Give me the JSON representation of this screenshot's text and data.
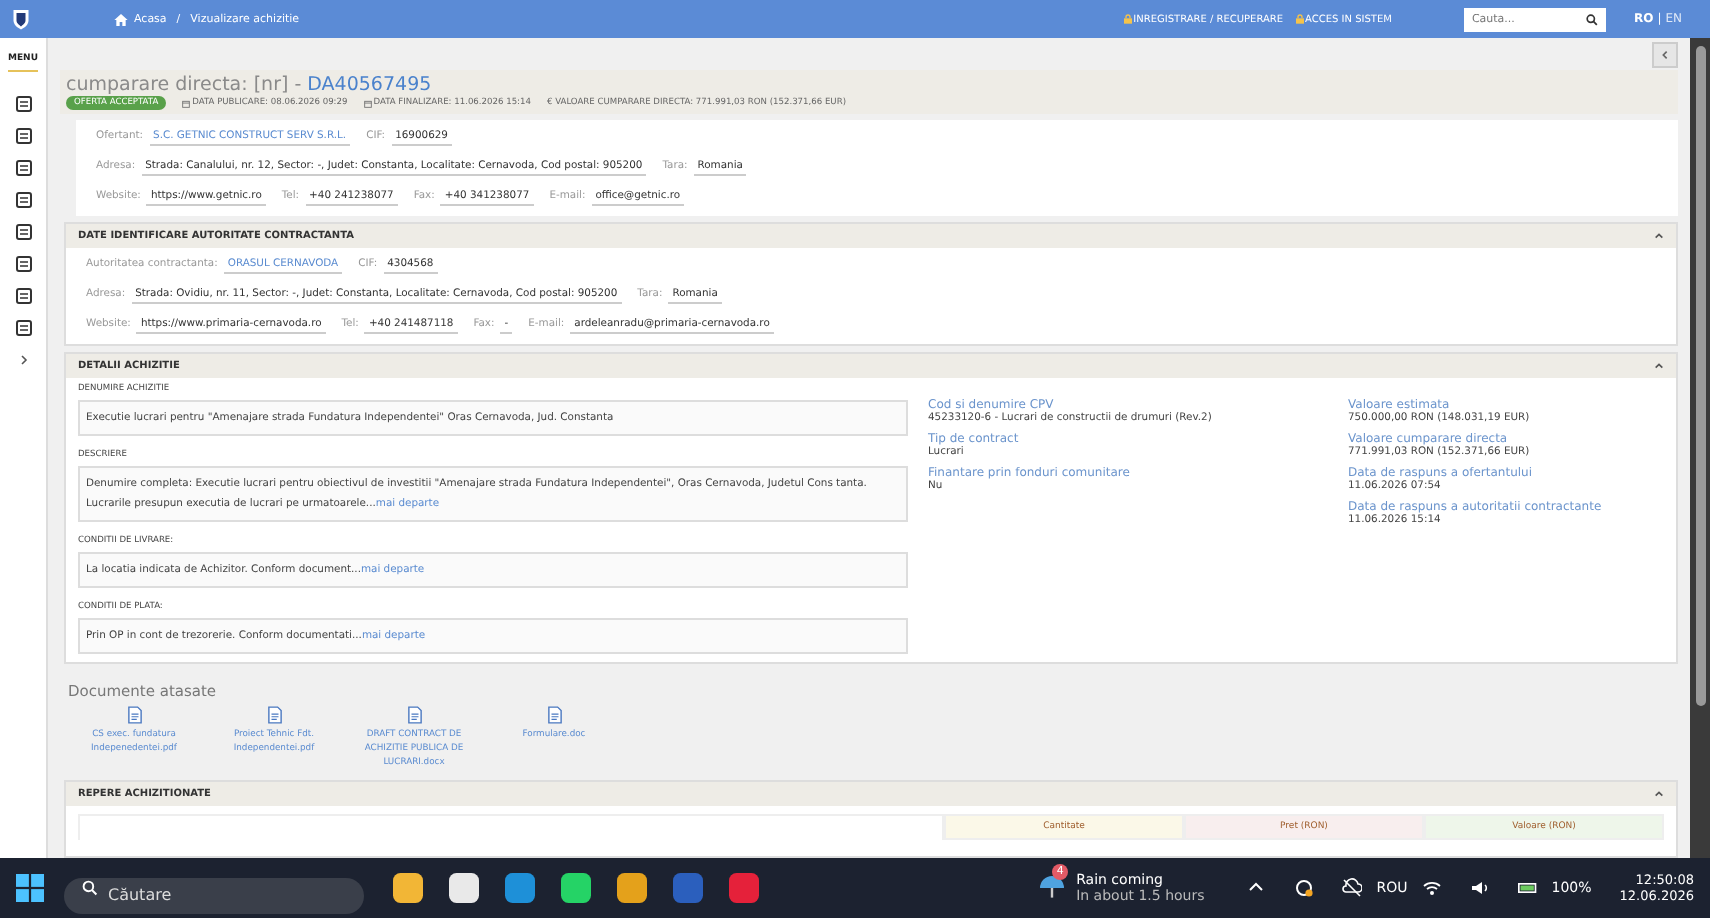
{
  "header": {
    "breadcrumb": [
      "Acasa",
      "Vizualizare achizitie"
    ],
    "breadcrumb_separator": "/",
    "links": [
      "INREGISTRARE / RECUPERARE",
      "ACCES IN SISTEM"
    ],
    "search": {
      "placeholder": "Cauta..."
    },
    "languages": [
      {
        "label": "RO",
        "selected": true
      },
      {
        "label": "EN",
        "selected": false
      }
    ],
    "language_separator": "|"
  },
  "sidebar": {
    "menu_label": "MENU"
  },
  "procurement": {
    "title": "cumparare directa: [nr] - ",
    "code": "DA40567495",
    "status": "OFERTA ACCEPTATA",
    "meta": [
      {
        "kind": "date",
        "text": "DATA PUBLICARE: 08.06.2026 09:29"
      },
      {
        "kind": "date",
        "text": "DATA FINALIZARE: 11.06.2026 15:14"
      },
      {
        "kind": "money",
        "text": "€ VALOARE CUMPARARE DIRECTA: 771.991,03  RON (152.371,66  EUR)"
      }
    ]
  },
  "bidder": {
    "lines": [
      {
        "fields": [
          {
            "label": "Ofertant:",
            "value": "S.C. GETNIC CONSTRUCT SERV S.R.L.",
            "link": true
          },
          {
            "label": "CIF:",
            "value": "16900629",
            "link": false
          }
        ]
      },
      {
        "fields": [
          {
            "label": "Adresa:",
            "value": "Strada: Canalului, nr. 12, Sector: -, Judet: Constanta, Localitate: Cernavoda, Cod postal: 905200",
            "link": false
          },
          {
            "label": "Tara:",
            "value": "Romania",
            "link": false
          }
        ]
      },
      {
        "fields": [
          {
            "label": "Website:",
            "value": "https://www.getnic.ro",
            "link": false
          },
          {
            "label": "Tel:",
            "value": "+40 241238077",
            "link": false
          },
          {
            "label": "Fax:",
            "value": "+40 341238077",
            "link": false
          },
          {
            "label": "E-mail:",
            "value": "office@getnic.ro",
            "link": false
          }
        ]
      }
    ]
  },
  "authority": {
    "title": "DATE IDENTIFICARE AUTORITATE CONTRACTANTA",
    "expanded": true,
    "lines": [
      {
        "fields": [
          {
            "label": "Autoritatea contractanta:",
            "value": "ORASUL CERNAVODA",
            "link": true
          },
          {
            "label": "CIF:",
            "value": "4304568",
            "link": false
          }
        ]
      },
      {
        "fields": [
          {
            "label": "Adresa:",
            "value": "Strada: Ovidiu, nr. 11, Sector: -, Judet: Constanta, Localitate: Cernavoda, Cod postal: 905200",
            "link": false
          },
          {
            "label": "Tara:",
            "value": "Romania",
            "link": false
          }
        ]
      },
      {
        "fields": [
          {
            "label": "Website:",
            "value": "https://www.primaria-cernavoda.ro",
            "link": false
          },
          {
            "label": "Tel:",
            "value": "+40 241487118",
            "link": false
          },
          {
            "label": "Fax:",
            "value": "-",
            "link": false
          },
          {
            "label": "E-mail:",
            "value": "ardeleanradu@primaria-cernavoda.ro",
            "link": false
          }
        ]
      }
    ]
  },
  "details": {
    "title": "DETALII ACHIZITIE",
    "expanded": true,
    "fields": [
      {
        "label": "DENUMIRE ACHIZITIE",
        "value": "Executie lucrari pentru \"Amenajare strada Fundatura Independentei\" Oras Cernavoda, Jud. Constanta"
      },
      {
        "label": "DESCRIERE",
        "value": "Denumire completa: Executie lucrari pentru obiectivul de investitii \"Amenajare strada Fundatura Independentei\", Oras Cernavoda, Judetul Cons tanta. Lucrarile presupun executia de lucrari pe urmatoarele...",
        "more": "mai departe"
      },
      {
        "label": "CONDITII DE LIVRARE:",
        "value": "La locatia indicata de Achizitor. Conform document...",
        "more": "mai departe"
      },
      {
        "label": "CONDITII DE PLATA:",
        "value": "Prin OP in cont de trezorerie. Conform documentati...",
        "more": "mai departe"
      }
    ],
    "column_2": [
      {
        "label": "Cod si denumire CPV",
        "value": "45233120-6 - Lucrari de constructii de drumuri (Rev.2)"
      },
      {
        "label": "Tip de contract",
        "value": "Lucrari"
      },
      {
        "label": "Finantare prin fonduri comunitare",
        "value": "Nu"
      }
    ],
    "column_3": [
      {
        "label": "Valoare estimata",
        "value": "750.000,00  RON (148.031,19  EUR)"
      },
      {
        "label": "Valoare cumparare directa",
        "value": "771.991,03  RON (152.371,66  EUR)"
      },
      {
        "label": "Data de raspuns a ofertantului",
        "value": "11.06.2026 07:54"
      },
      {
        "label": "Data de raspuns a autoritatii contractante",
        "value": "11.06.2026 15:14"
      }
    ]
  },
  "documents": {
    "title": "Documente atasate",
    "files": [
      "CS exec. fundatura Indepenedentei.pdf",
      "Proiect Tehnic Fdt. Independentei.pdf",
      "DRAFT CONTRACT DE ACHIZITIE PUBLICA DE LUCRARI.docx",
      "Formulare.doc"
    ]
  },
  "items": {
    "title": "REPERE ACHIZITIONATE",
    "expanded": true,
    "columns": [
      {
        "label": "Cantitate",
        "color": "#fbf8e8"
      },
      {
        "label": "Pret (RON)",
        "color": "#f8eeee"
      },
      {
        "label": "Valoare (RON)",
        "color": "#eef6ea"
      }
    ]
  },
  "taskbar": {
    "search": {
      "placeholder": "Căutare"
    },
    "weather": {
      "badge": "4",
      "title": "Rain coming",
      "subtitle": "In about 1.5 hours"
    },
    "language": "ROU",
    "battery": "100%",
    "time": "12:50:08",
    "date": "12.06.2026"
  }
}
